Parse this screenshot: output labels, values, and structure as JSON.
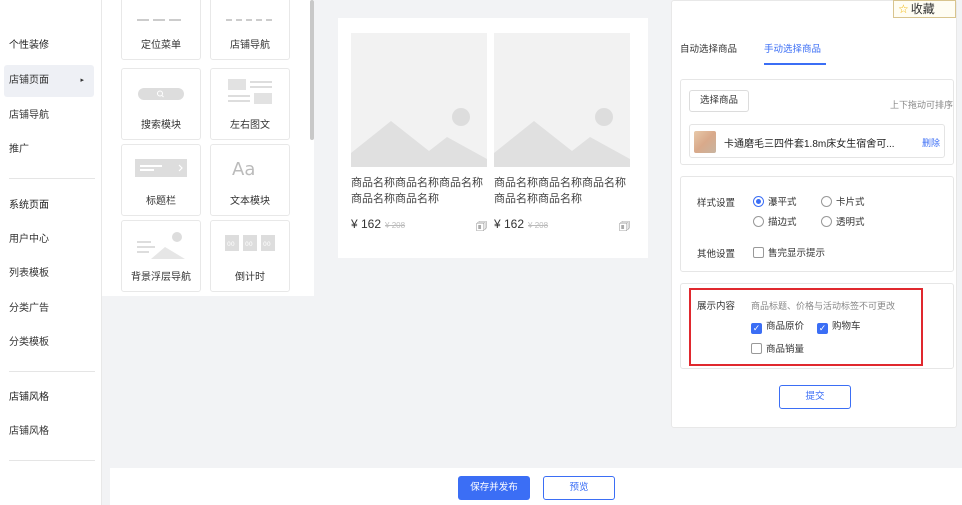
{
  "nav": {
    "items": [
      {
        "label": "个性装修"
      },
      {
        "label": "店铺页面",
        "active": true
      },
      {
        "label": "店铺导航"
      },
      {
        "label": "推广"
      },
      {
        "label": "系统页面"
      },
      {
        "label": "用户中心"
      },
      {
        "label": "列表模板"
      },
      {
        "label": "分类广告"
      },
      {
        "label": "分类模板"
      },
      {
        "label": "店铺风格"
      },
      {
        "label": "店铺风格"
      }
    ],
    "active_arrow": "▸"
  },
  "palette": {
    "tiles": [
      {
        "label": "定位菜单"
      },
      {
        "label": "店铺导航"
      },
      {
        "label": "搜索模块"
      },
      {
        "label": "左右图文"
      },
      {
        "label": "标题栏"
      },
      {
        "label": "文本模块"
      },
      {
        "label": "背景浮层导航"
      },
      {
        "label": "倒计时"
      }
    ]
  },
  "preview": {
    "products": [
      {
        "name": "商品名称商品名称商品名称商品名称商品名称",
        "price": "¥ 162",
        "orig_price": "¥ 208"
      },
      {
        "name": "商品名称商品名称商品名称商品名称商品名称",
        "price": "¥ 162",
        "orig_price": "¥ 208"
      }
    ]
  },
  "panel": {
    "tabs": [
      {
        "label": "自动选择商品"
      },
      {
        "label": "手动选择商品",
        "active": true
      }
    ],
    "select_button": "选择商品",
    "sort_hint": "上下拖动可排序",
    "selected_item": {
      "name": "卡通磨毛三四件套1.8m床女生宿舍可...",
      "delete": "删除"
    },
    "style_label": "样式设置",
    "style_options": [
      {
        "label": "瀑平式",
        "checked": true
      },
      {
        "label": "卡片式",
        "checked": false
      },
      {
        "label": "描边式",
        "checked": false
      },
      {
        "label": "透明式",
        "checked": false
      }
    ],
    "other_label": "其他设置",
    "other_option": {
      "label": "售完显示提示",
      "checked": false
    },
    "display_label": "展示内容",
    "display_hint": "商品标题、价格与活动标签不可更改",
    "display_options": [
      {
        "label": "商品原价",
        "checked": true
      },
      {
        "label": "购物车",
        "checked": true
      },
      {
        "label": "商品销量",
        "checked": false
      }
    ],
    "submit": "提交"
  },
  "footer": {
    "save_publish": "保存并发布",
    "preview": "预览"
  },
  "favorite": {
    "label": "收藏",
    "icon": "star-icon"
  },
  "colors": {
    "accent": "#3b6ef5",
    "highlight": "#e0282e"
  }
}
